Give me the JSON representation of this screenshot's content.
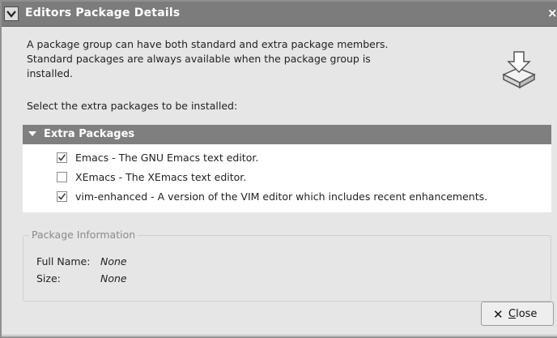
{
  "window": {
    "title": "Editors Package Details",
    "close_glyph": "×"
  },
  "description": "A package group can have both standard and extra package members.  Standard packages are always available when the package group is installed.",
  "select_prompt": "Select the extra packages to be installed:",
  "extra_packages": {
    "header": "Extra Packages",
    "items": [
      {
        "label": "Emacs - The GNU Emacs text editor.",
        "checked": true
      },
      {
        "label": "XEmacs - The XEmacs text editor.",
        "checked": false
      },
      {
        "label": "vim-enhanced - A version of the VIM editor which includes recent enhancements.",
        "checked": true
      }
    ]
  },
  "package_info": {
    "title": "Package Information",
    "full_name_label": "Full Name:",
    "full_name_value": "None",
    "size_label": "Size:",
    "size_value": "None"
  },
  "close_button": {
    "glyph": "✕",
    "label": "Close"
  },
  "icons": {
    "title_menu": "chevron-down-icon",
    "package": "package-install-icon",
    "close": "close-icon"
  }
}
